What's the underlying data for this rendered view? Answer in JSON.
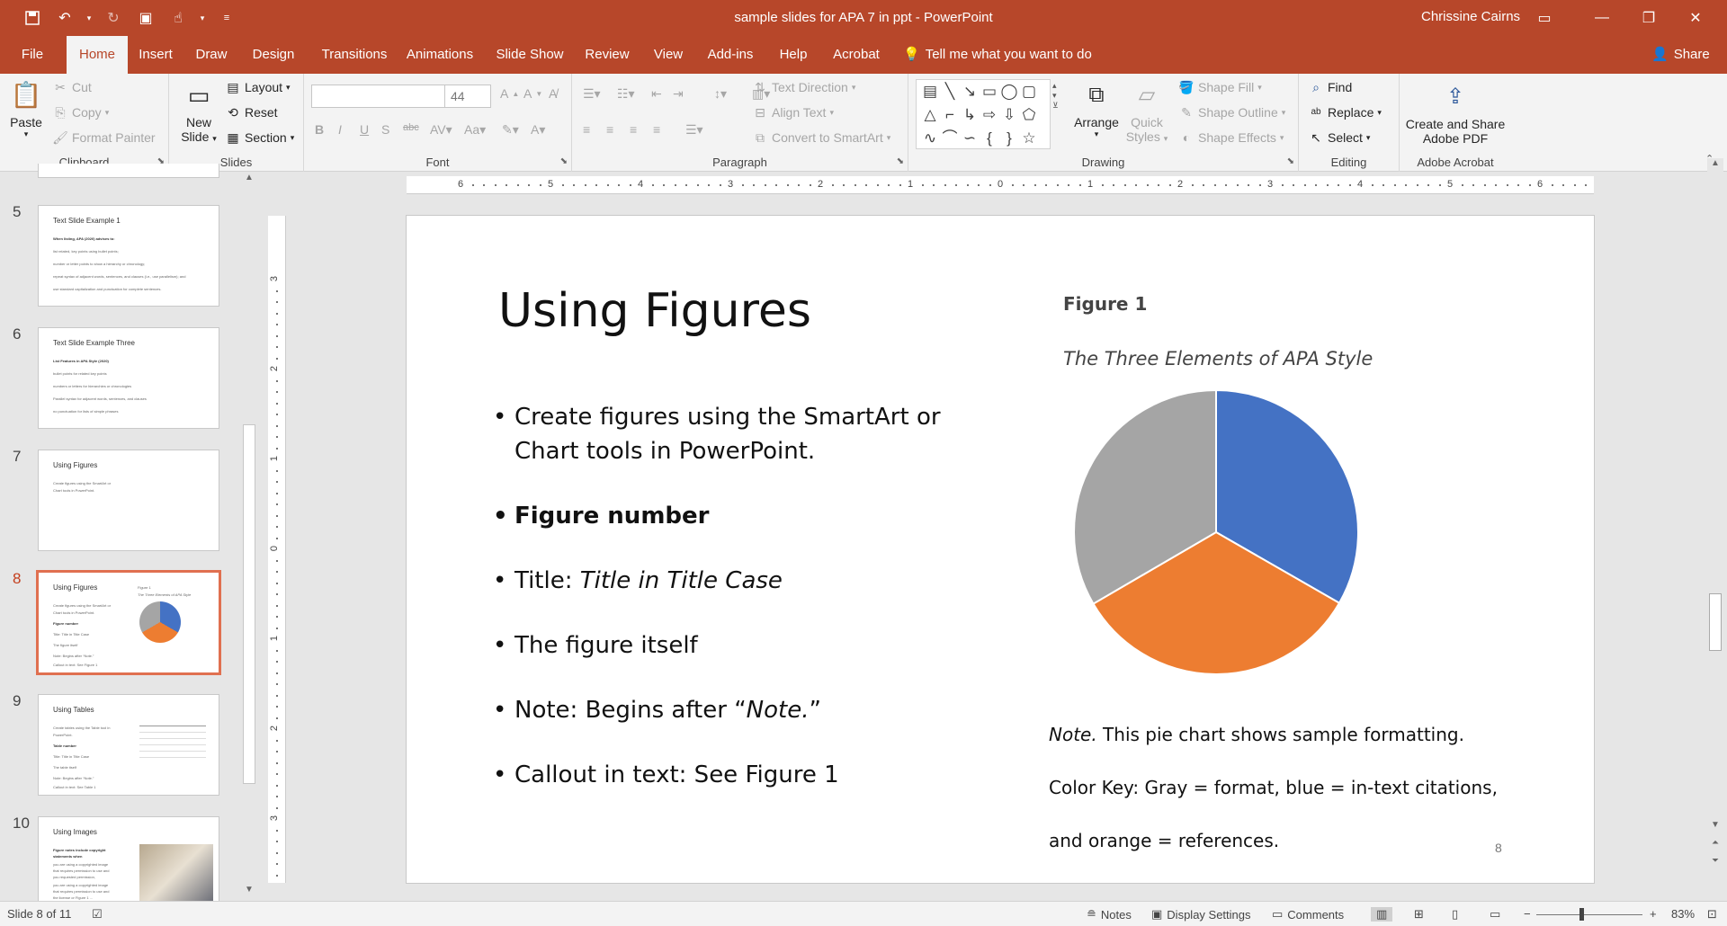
{
  "window": {
    "doc_title": "sample slides for APA 7 in ppt  -  PowerPoint",
    "user": "Chrissine Cairns"
  },
  "tabs": [
    "File",
    "Home",
    "Insert",
    "Draw",
    "Design",
    "Transitions",
    "Animations",
    "Slide Show",
    "Review",
    "View",
    "Add-ins",
    "Help",
    "Acrobat"
  ],
  "tell_me": "Tell me what you want to do",
  "share": "Share",
  "ribbon": {
    "clipboard": {
      "label": "Clipboard",
      "paste": "Paste",
      "cut": "Cut",
      "copy": "Copy",
      "format_painter": "Format Painter"
    },
    "slides": {
      "label": "Slides",
      "new_slide_1": "New",
      "new_slide_2": "Slide",
      "layout": "Layout",
      "reset": "Reset",
      "section": "Section"
    },
    "font": {
      "label": "Font",
      "font_name": "",
      "font_size": "44"
    },
    "paragraph": {
      "label": "Paragraph",
      "text_direction": "Text Direction",
      "align_text": "Align Text",
      "convert_smartart": "Convert to SmartArt"
    },
    "drawing": {
      "label": "Drawing",
      "arrange": "Arrange",
      "quick_styles_1": "Quick",
      "quick_styles_2": "Styles",
      "shape_fill": "Shape Fill",
      "shape_outline": "Shape Outline",
      "shape_effects": "Shape Effects"
    },
    "editing": {
      "label": "Editing",
      "find": "Find",
      "replace": "Replace",
      "select": "Select"
    },
    "acrobat": {
      "label": "Adobe Acrobat",
      "create_1": "Create and Share",
      "create_2": "Adobe PDF"
    }
  },
  "thumbnails": [
    {
      "num": "5",
      "title": "Text Slide Example 1",
      "lines": [
        "When listing, APA (2020) advises to:",
        "list related, key points using bullet points;",
        "number or letter points to show a hierarchy or chronology;",
        "repeat syntax of adjacent words, sentences, and clauses (i.e., use parallelism); and",
        "use standard capitalization and punctuation for complete sentences."
      ]
    },
    {
      "num": "6",
      "title": "Text Slide Example Three",
      "lines": [
        "List Features in APA Style (2020)",
        "bullet points for related key points",
        "numbers or letters for hierarchies or chronologies",
        "Parallel syntax for adjacent words, sentences, and clauses",
        "no punctuation for lists of simple phrases"
      ]
    },
    {
      "num": "7",
      "title": "Using Figures",
      "lines": [
        "Create figures using the SmartArt or",
        "Chart tools in PowerPoint."
      ]
    },
    {
      "num": "8",
      "title": "Using Figures",
      "lines": [
        "Create figures using the SmartArt or",
        "Chart tools in PowerPoint.",
        "Figure number",
        "Title: Title in Title Case",
        "The figure itself",
        "Note: Begins after “Note.”",
        "Callout in text: See Figure 1"
      ]
    },
    {
      "num": "9",
      "title": "Using Tables",
      "lines": [
        "Create tables using the Table tool in",
        "PowerPoint.",
        "Table number",
        "Title: Title in Title Case",
        "The table itself",
        "Note: Begins after “Note.”",
        "Callout in text: See Table 1"
      ]
    },
    {
      "num": "10",
      "title": "Using Images",
      "lines": [
        "Figure notes include copyright",
        "statements when",
        "you are using a copyrighted image",
        "that requires permission to use and",
        "you requested permission,",
        "you are using a copyrighted image",
        "that requires permission to use and",
        "the license or Figure 1 ..."
      ]
    }
  ],
  "slide": {
    "title": "Using Figures",
    "bullets": [
      {
        "text": "Create figures using the SmartArt or Chart tools in PowerPoint.",
        "style": "normal"
      },
      {
        "text": "Figure number",
        "style": "bold"
      },
      {
        "prefix": "Title: ",
        "text": "Title in Title Case",
        "style": "mixed-italic"
      },
      {
        "text": "The figure itself",
        "style": "normal"
      },
      {
        "prefix": "Note: Begins after “",
        "text": "Note.",
        "suffix": "”",
        "style": "mixed-italic"
      },
      {
        "text": "Callout in text: See Figure 1",
        "style": "normal"
      }
    ],
    "figure_number": "Figure 1",
    "figure_title": "The Three Elements of APA Style",
    "note_label": "Note.",
    "note_text": " This pie chart shows sample formatting.",
    "color_key_1": "Color Key: Gray = format, blue = in-text citations,",
    "color_key_2": "and orange = references.",
    "page_number": "8"
  },
  "chart_data": {
    "type": "pie",
    "categories": [
      "in-text citations",
      "references",
      "format"
    ],
    "values": [
      33.3,
      33.3,
      33.4
    ],
    "colors": [
      "#4472c4",
      "#ed7d31",
      "#a5a5a5"
    ],
    "title": "The Three Elements of APA Style"
  },
  "ruler": {
    "h_labels": [
      "6",
      "5",
      "4",
      "3",
      "2",
      "1",
      "0",
      "1",
      "2",
      "3",
      "4",
      "5",
      "6"
    ],
    "v_labels": [
      "3",
      "2",
      "1",
      "0",
      "1",
      "2",
      "3"
    ]
  },
  "status": {
    "slide_info": "Slide 8 of 11",
    "notes": "Notes",
    "display_settings": "Display Settings",
    "comments": "Comments",
    "zoom": "83%"
  }
}
